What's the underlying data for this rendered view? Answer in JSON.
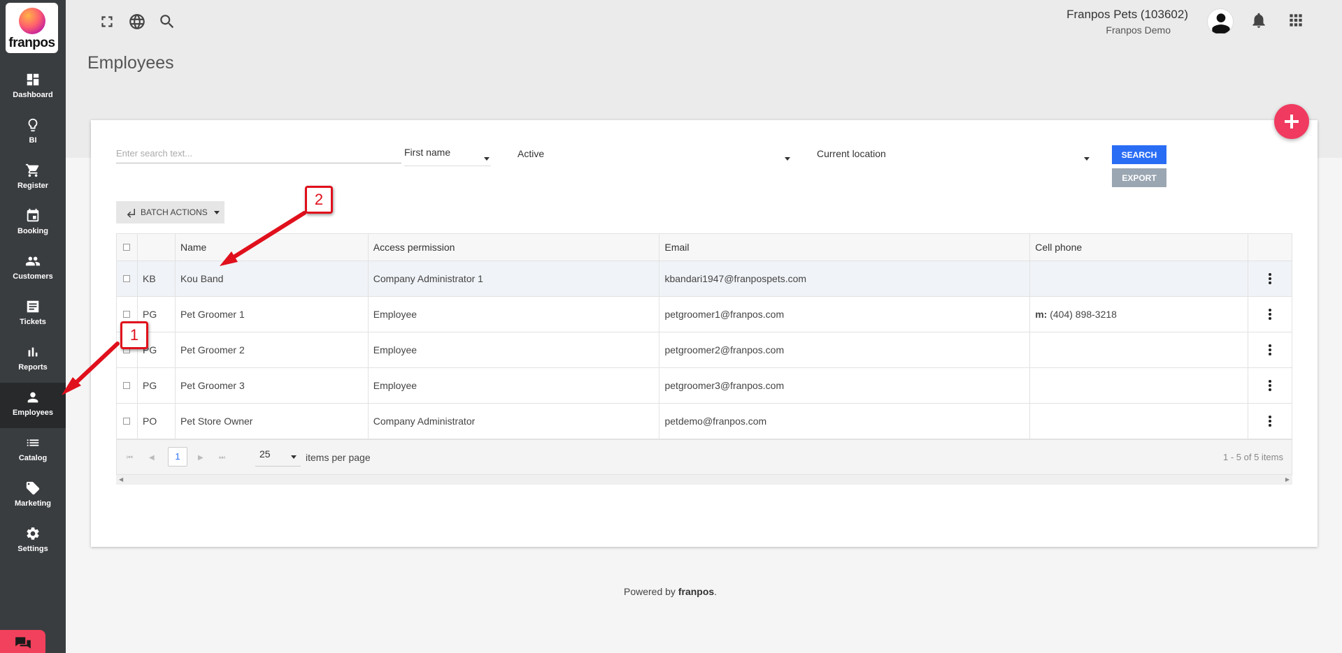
{
  "brand": {
    "logo_text": "franpos"
  },
  "sidebar": {
    "items": [
      {
        "label": "Dashboard",
        "icon": "dashboard-icon"
      },
      {
        "label": "BI",
        "icon": "lightbulb-icon"
      },
      {
        "label": "Register",
        "icon": "cart-icon"
      },
      {
        "label": "Booking",
        "icon": "calendar-icon"
      },
      {
        "label": "Customers",
        "icon": "people-icon"
      },
      {
        "label": "Tickets",
        "icon": "ticket-icon"
      },
      {
        "label": "Reports",
        "icon": "bar-chart-icon"
      },
      {
        "label": "Employees",
        "icon": "person-icon",
        "active": true
      },
      {
        "label": "Catalog",
        "icon": "list-icon"
      },
      {
        "label": "Marketing",
        "icon": "tag-icon"
      },
      {
        "label": "Settings",
        "icon": "gear-icon"
      }
    ]
  },
  "header": {
    "account_name": "Franpos Pets (103602)",
    "account_sub": "Franpos Demo"
  },
  "page": {
    "title": "Employees"
  },
  "filters": {
    "search_placeholder": "Enter search text...",
    "sort_field": "First name",
    "status": "Active",
    "location": "Current location",
    "search_label": "SEARCH",
    "export_label": "EXPORT",
    "batch_label": "BATCH ACTIONS"
  },
  "table": {
    "columns": [
      "Name",
      "Access permission",
      "Email",
      "Cell phone"
    ],
    "rows": [
      {
        "initials": "KB",
        "name": "Kou Band",
        "access": "Company Administrator 1",
        "email": "kbandari1947@franpospets.com",
        "phone_prefix": "",
        "phone": ""
      },
      {
        "initials": "PG",
        "name": "Pet Groomer 1",
        "access": "Employee",
        "email": "petgroomer1@franpos.com",
        "phone_prefix": "m:",
        "phone": "(404) 898-3218"
      },
      {
        "initials": "PG",
        "name": "Pet Groomer 2",
        "access": "Employee",
        "email": "petgroomer2@franpos.com",
        "phone_prefix": "",
        "phone": ""
      },
      {
        "initials": "PG",
        "name": "Pet Groomer 3",
        "access": "Employee",
        "email": "petgroomer3@franpos.com",
        "phone_prefix": "",
        "phone": ""
      },
      {
        "initials": "PO",
        "name": "Pet Store Owner",
        "access": "Company Administrator",
        "email": "petdemo@franpos.com",
        "phone_prefix": "",
        "phone": ""
      }
    ]
  },
  "pager": {
    "current_page": "1",
    "page_size": "25",
    "items_per_page_label": "items per page",
    "info": "1 - 5 of 5 items"
  },
  "footer": {
    "prefix": "Powered by",
    "brand": "franpos",
    "suffix": "."
  },
  "annotations": {
    "badge1": "1",
    "badge2": "2"
  },
  "colors": {
    "accent": "#2a6df5",
    "fab": "#f03a5f",
    "annotation": "#e0101c",
    "sidebar": "#3a3d40"
  }
}
